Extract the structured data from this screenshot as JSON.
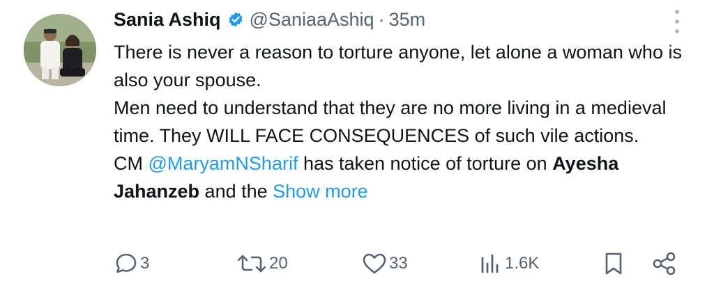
{
  "author": {
    "name": "Sania Ashiq",
    "handle": "@SaniaaAshiq",
    "separator": "·",
    "time": "35m"
  },
  "tweet": {
    "line1": "There is never a reason to torture anyone, let alone a woman who is also your spouse.",
    "line2": "Men need to understand that they are no more living in a medieval time. They WILL FACE CONSEQUENCES of such vile actions.",
    "line3_prefix": "CM ",
    "mention": "@MaryamNSharif",
    "line3_mid": " has taken notice of torture on ",
    "bold_name": "Ayesha Jahanzeb",
    "line3_suffix": " and the ",
    "show_more": "Show more"
  },
  "actions": {
    "replies": "3",
    "reposts": "20",
    "likes": "33",
    "views": "1.6K"
  },
  "colors": {
    "accent": "#1d9bf0",
    "secondary_text": "#536471",
    "primary_text": "#0f1419"
  },
  "icons": [
    "verified-badge-icon",
    "more-options-icon",
    "reply-icon",
    "repost-icon",
    "like-icon",
    "views-icon",
    "bookmark-icon",
    "share-icon"
  ]
}
